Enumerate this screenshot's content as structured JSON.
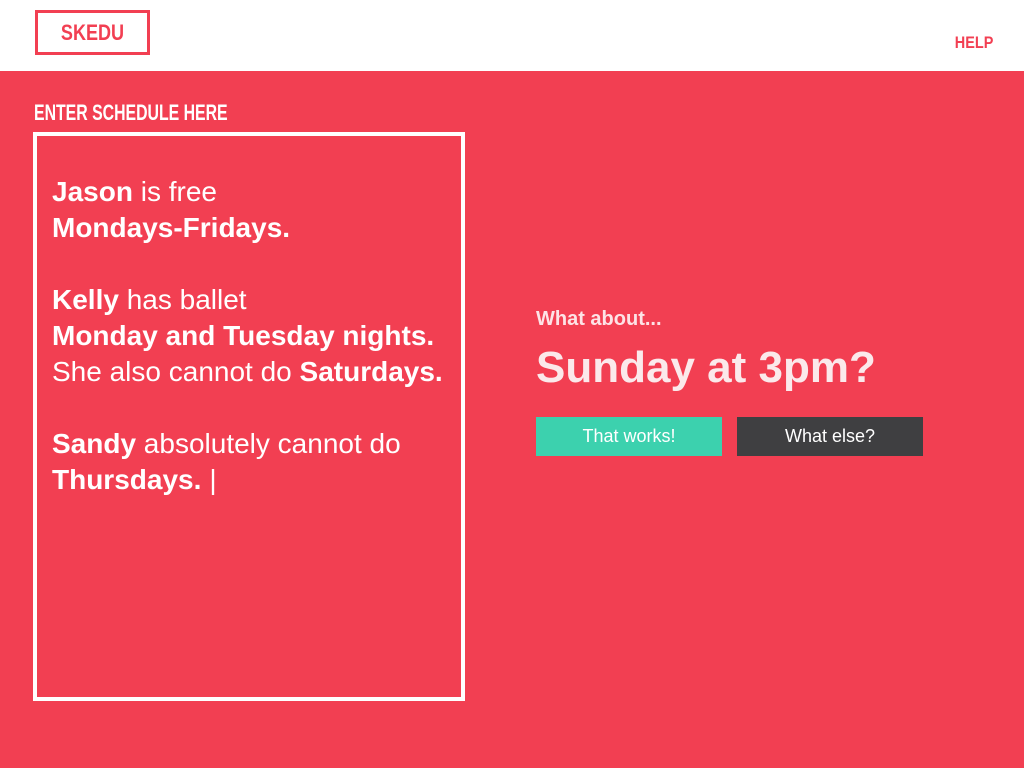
{
  "header": {
    "logo_text": "SKEDU",
    "help_label": "HELP"
  },
  "schedule": {
    "label": "ENTER SCHEDULE HERE",
    "entries": [
      {
        "name": "Jason",
        "text_1": " is free",
        "bold_1": "Mondays-Fridays."
      },
      {
        "name": "Kelly",
        "text_1": " has ballet",
        "bold_1": "Monday and Tuesday nights.",
        "text_2": " She also cannot do ",
        "bold_2": "Saturdays."
      },
      {
        "name": "Sandy",
        "text_1": " absolutely cannot do ",
        "bold_1": "Thursdays.",
        "caret": "|"
      }
    ]
  },
  "suggestion": {
    "prompt": "What about...",
    "time": "Sunday at 3pm?",
    "accept_label": "That works!",
    "reject_label": "What else?"
  },
  "colors": {
    "background": "#f23f52",
    "accept": "#3cd1ae",
    "reject": "#3f3f41"
  }
}
